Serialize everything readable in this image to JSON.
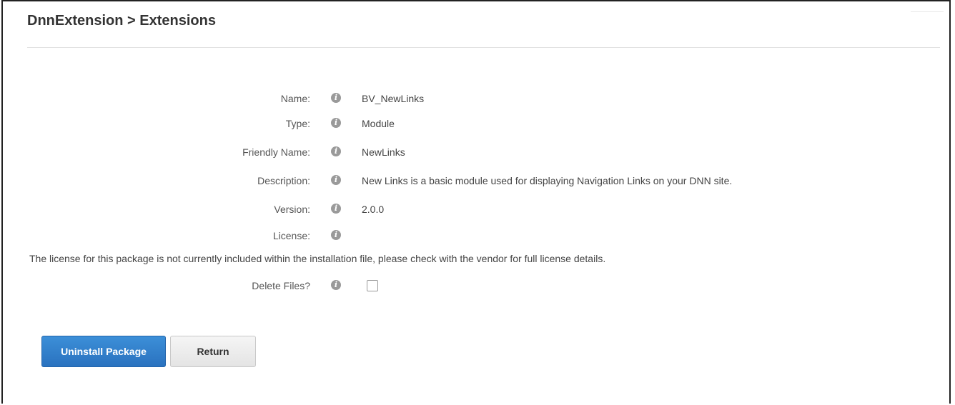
{
  "header": {
    "title": "DnnExtension > Extensions"
  },
  "fields": [
    {
      "label": "Name:",
      "value": "BV_NewLinks"
    },
    {
      "label": "Type:",
      "value": "Module"
    },
    {
      "label": "Friendly Name:",
      "value": "NewLinks"
    },
    {
      "label": "Description:",
      "value": "New Links is a basic module used for displaying Navigation Links on your DNN site."
    },
    {
      "label": "Version:",
      "value": "2.0.0"
    },
    {
      "label": "License:",
      "value": ""
    }
  ],
  "license_note": "The license for this package is not currently included within the installation file, please check with the vendor for full license details.",
  "delete_files": {
    "label": "Delete Files?",
    "checked": false
  },
  "buttons": {
    "uninstall": "Uninstall Package",
    "return": "Return"
  },
  "icons": {
    "info": "info-icon",
    "info_glyph": "i"
  },
  "colors": {
    "primary": "#2a72bf",
    "icon": "#9a9a9a"
  }
}
